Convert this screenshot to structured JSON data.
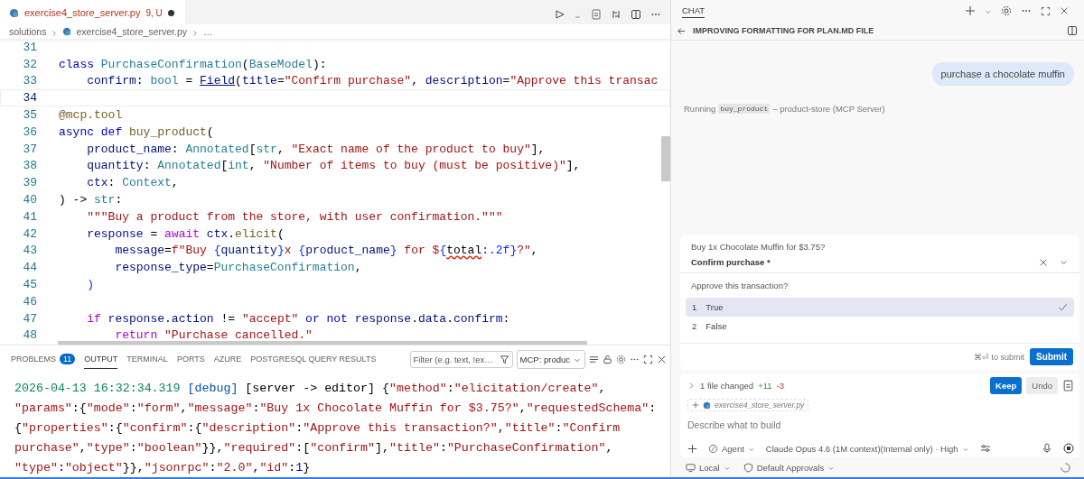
{
  "editor": {
    "tab": {
      "filename": "exercise4_store_server.py",
      "badge": "9, U",
      "dirty": true
    },
    "breadcrumb": [
      "solutions",
      "exercise4_store_server.py",
      "…"
    ],
    "lines": [
      {
        "number": "31",
        "current": false
      },
      {
        "number": "32",
        "current": false,
        "tokens": [
          {
            "kind": "kw",
            "text": "class "
          },
          {
            "kind": "type",
            "text": "PurchaseConfirmation"
          },
          {
            "kind": "plain",
            "text": "("
          },
          {
            "kind": "type",
            "text": "BaseModel"
          },
          {
            "kind": "plain",
            "text": "):"
          }
        ]
      },
      {
        "number": "33",
        "current": false,
        "tokens": [
          {
            "kind": "var",
            "text": "    confirm"
          },
          {
            "kind": "plain",
            "text": ": "
          },
          {
            "kind": "type",
            "text": "bool"
          },
          {
            "kind": "plain",
            "text": " = "
          },
          {
            "kind": "link",
            "text": "Field"
          },
          {
            "kind": "plain",
            "text": "("
          },
          {
            "kind": "var",
            "text": "title"
          },
          {
            "kind": "plain",
            "text": "="
          },
          {
            "kind": "str",
            "text": "\"Confirm purchase\""
          },
          {
            "kind": "plain",
            "text": ", "
          },
          {
            "kind": "var",
            "text": "description"
          },
          {
            "kind": "plain",
            "text": "="
          },
          {
            "kind": "str",
            "text": "\"Approve this transac"
          }
        ]
      },
      {
        "number": "34",
        "current": true
      },
      {
        "number": "35",
        "current": false,
        "tokens": [
          {
            "kind": "deco",
            "text": "@mcp.tool"
          }
        ]
      },
      {
        "number": "36",
        "current": false,
        "tokens": [
          {
            "kind": "kw",
            "text": "async def "
          },
          {
            "kind": "fn",
            "text": "buy_product"
          },
          {
            "kind": "plain",
            "text": "("
          }
        ]
      },
      {
        "number": "37",
        "current": false,
        "tokens": [
          {
            "kind": "var",
            "text": "    product_name"
          },
          {
            "kind": "plain",
            "text": ": "
          },
          {
            "kind": "type",
            "text": "Annotated"
          },
          {
            "kind": "plain",
            "text": "["
          },
          {
            "kind": "type",
            "text": "str"
          },
          {
            "kind": "plain",
            "text": ", "
          },
          {
            "kind": "str",
            "text": "\"Exact name of the product to buy\""
          },
          {
            "kind": "plain",
            "text": "],"
          }
        ]
      },
      {
        "number": "38",
        "current": false,
        "tokens": [
          {
            "kind": "var",
            "text": "    quantity"
          },
          {
            "kind": "plain",
            "text": ": "
          },
          {
            "kind": "type",
            "text": "Annotated"
          },
          {
            "kind": "plain",
            "text": "["
          },
          {
            "kind": "type",
            "text": "int"
          },
          {
            "kind": "plain",
            "text": ", "
          },
          {
            "kind": "str",
            "text": "\"Number of items to buy (must be positive)\""
          },
          {
            "kind": "plain",
            "text": "],"
          }
        ]
      },
      {
        "number": "39",
        "current": false,
        "tokens": [
          {
            "kind": "var",
            "text": "    ctx"
          },
          {
            "kind": "plain",
            "text": ": "
          },
          {
            "kind": "type",
            "text": "Context"
          },
          {
            "kind": "plain",
            "text": ","
          }
        ]
      },
      {
        "number": "40",
        "current": false,
        "tokens": [
          {
            "kind": "plain",
            "text": ") -> "
          },
          {
            "kind": "type",
            "text": "str"
          },
          {
            "kind": "plain",
            "text": ":"
          }
        ]
      },
      {
        "number": "41",
        "current": false,
        "tokens": [
          {
            "kind": "str",
            "text": "    \"\"\"Buy a product from the store, with user confirmation.\"\"\""
          }
        ]
      },
      {
        "number": "42",
        "current": false,
        "tokens": [
          {
            "kind": "var",
            "text": "    response"
          },
          {
            "kind": "plain",
            "text": " = "
          },
          {
            "kind": "ctrl",
            "text": "await "
          },
          {
            "kind": "var",
            "text": "ctx"
          },
          {
            "kind": "plain",
            "text": "."
          },
          {
            "kind": "fn",
            "text": "elicit"
          },
          {
            "kind": "plain",
            "text": "("
          }
        ]
      },
      {
        "number": "43",
        "current": false,
        "tokens": [
          {
            "kind": "var",
            "text": "        message"
          },
          {
            "kind": "plain",
            "text": "="
          },
          {
            "kind": "str",
            "text": "f\"Buy "
          },
          {
            "kind": "brace",
            "text": "{"
          },
          {
            "kind": "var",
            "text": "quantity"
          },
          {
            "kind": "brace",
            "text": "}"
          },
          {
            "kind": "str",
            "text": "x "
          },
          {
            "kind": "brace",
            "text": "{"
          },
          {
            "kind": "var",
            "text": "product_name"
          },
          {
            "kind": "brace",
            "text": "}"
          },
          {
            "kind": "str",
            "text": " for $"
          },
          {
            "kind": "brace",
            "text": "{"
          },
          {
            "kind": "err",
            "text": "total"
          },
          {
            "kind": "brace",
            "text": ":.2f}"
          },
          {
            "kind": "str",
            "text": "?\""
          },
          {
            "kind": "plain",
            "text": ","
          }
        ]
      },
      {
        "number": "44",
        "current": false,
        "tokens": [
          {
            "kind": "var",
            "text": "        response_type"
          },
          {
            "kind": "plain",
            "text": "="
          },
          {
            "kind": "type",
            "text": "PurchaseConfirmation"
          },
          {
            "kind": "plain",
            "text": ","
          }
        ]
      },
      {
        "number": "45",
        "current": false,
        "tokens": [
          {
            "kind": "brace",
            "text": "    )"
          }
        ]
      },
      {
        "number": "46",
        "current": false
      },
      {
        "number": "47",
        "current": false,
        "tokens": [
          {
            "kind": "ctrl",
            "text": "    if "
          },
          {
            "kind": "var",
            "text": "response"
          },
          {
            "kind": "plain",
            "text": "."
          },
          {
            "kind": "var",
            "text": "action"
          },
          {
            "kind": "plain",
            "text": " != "
          },
          {
            "kind": "str",
            "text": "\"accept\""
          },
          {
            "kind": "kw",
            "text": " or not "
          },
          {
            "kind": "var",
            "text": "response"
          },
          {
            "kind": "plain",
            "text": "."
          },
          {
            "kind": "var",
            "text": "data"
          },
          {
            "kind": "plain",
            "text": "."
          },
          {
            "kind": "var",
            "text": "confirm"
          },
          {
            "kind": "plain",
            "text": ":"
          }
        ]
      },
      {
        "number": "48",
        "current": false,
        "tokens": [
          {
            "kind": "ctrl",
            "text": "        return "
          },
          {
            "kind": "str",
            "text": "\"Purchase cancelled.\""
          }
        ]
      }
    ]
  },
  "panel": {
    "tabs": [
      {
        "label": "PROBLEMS",
        "count": "11",
        "selected": false
      },
      {
        "label": "OUTPUT",
        "selected": true
      },
      {
        "label": "TERMINAL",
        "selected": false
      },
      {
        "label": "PORTS",
        "selected": false
      },
      {
        "label": "AZURE",
        "selected": false
      },
      {
        "label": "POSTGRESQL QUERY RESULTS",
        "selected": false
      }
    ],
    "filter": {
      "placeholder": "Filter (e.g. text, !ex…"
    },
    "channel": "MCP: produc",
    "log": [
      [
        {
          "kind": "time",
          "text": "2026-04-13 16:32:34.319 "
        },
        {
          "kind": "tag",
          "text": "[debug]"
        },
        {
          "kind": "plain",
          "text": " [server -> editor] {"
        },
        {
          "kind": "str",
          "text": "\"method\""
        },
        {
          "kind": "plain",
          "text": ":"
        },
        {
          "kind": "str",
          "text": "\"elicitation/create\""
        },
        {
          "kind": "plain",
          "text": ","
        }
      ],
      [
        {
          "kind": "str",
          "text": "\"params\""
        },
        {
          "kind": "plain",
          "text": ":{"
        },
        {
          "kind": "str",
          "text": "\"mode\""
        },
        {
          "kind": "plain",
          "text": ":"
        },
        {
          "kind": "str",
          "text": "\"form\""
        },
        {
          "kind": "plain",
          "text": ","
        },
        {
          "kind": "str",
          "text": "\"message\""
        },
        {
          "kind": "plain",
          "text": ":"
        },
        {
          "kind": "str",
          "text": "\"Buy 1x Chocolate Muffin for $3.75?\""
        },
        {
          "kind": "plain",
          "text": ","
        },
        {
          "kind": "str",
          "text": "\"requestedSchema\""
        },
        {
          "kind": "plain",
          "text": ":"
        }
      ],
      [
        {
          "kind": "plain",
          "text": "{"
        },
        {
          "kind": "str",
          "text": "\"properties\""
        },
        {
          "kind": "plain",
          "text": ":{"
        },
        {
          "kind": "str",
          "text": "\"confirm\""
        },
        {
          "kind": "plain",
          "text": ":{"
        },
        {
          "kind": "str",
          "text": "\"description\""
        },
        {
          "kind": "plain",
          "text": ":"
        },
        {
          "kind": "str",
          "text": "\"Approve this transaction?\""
        },
        {
          "kind": "plain",
          "text": ","
        },
        {
          "kind": "str",
          "text": "\"title\""
        },
        {
          "kind": "plain",
          "text": ":"
        },
        {
          "kind": "str",
          "text": "\"Confirm"
        }
      ],
      [
        {
          "kind": "str",
          "text": "purchase\""
        },
        {
          "kind": "plain",
          "text": ","
        },
        {
          "kind": "str",
          "text": "\"type\""
        },
        {
          "kind": "plain",
          "text": ":"
        },
        {
          "kind": "str",
          "text": "\"boolean\""
        },
        {
          "kind": "plain",
          "text": "}},"
        },
        {
          "kind": "str",
          "text": "\"required\""
        },
        {
          "kind": "plain",
          "text": ":["
        },
        {
          "kind": "str",
          "text": "\"confirm\""
        },
        {
          "kind": "plain",
          "text": "],"
        },
        {
          "kind": "str",
          "text": "\"title\""
        },
        {
          "kind": "plain",
          "text": ":"
        },
        {
          "kind": "str",
          "text": "\"PurchaseConfirmation\""
        },
        {
          "kind": "plain",
          "text": ","
        }
      ],
      [
        {
          "kind": "str",
          "text": "\"type\""
        },
        {
          "kind": "plain",
          "text": ":"
        },
        {
          "kind": "str",
          "text": "\"object\""
        },
        {
          "kind": "plain",
          "text": "}},"
        },
        {
          "kind": "str",
          "text": "\"jsonrpc\""
        },
        {
          "kind": "plain",
          "text": ":"
        },
        {
          "kind": "str",
          "text": "\"2.0\""
        },
        {
          "kind": "plain",
          "text": ","
        },
        {
          "kind": "str",
          "text": "\"id\""
        },
        {
          "kind": "plain",
          "text": ":"
        },
        {
          "kind": "num",
          "text": "1"
        },
        {
          "kind": "plain",
          "text": "}"
        }
      ]
    ]
  },
  "chat": {
    "header": "CHAT",
    "title": "IMPROVING FORMATTING FOR PLAN.MD FILE",
    "user_message": "purchase a chocolate muffin",
    "status": {
      "prefix": "Running",
      "tool": "buy_product",
      "suffix": "– product-store (MCP Server)"
    },
    "form": {
      "message": "Buy 1x Chocolate Muffin for $3.75?",
      "field_title": "Confirm purchase *",
      "description": "Approve this transaction?",
      "options": [
        {
          "number": "1",
          "label": "True",
          "selected": true
        },
        {
          "number": "2",
          "label": "False",
          "selected": false
        }
      ],
      "hint": "⌘⏎ to submit",
      "submit": "Submit"
    },
    "changes": {
      "summary": "1 file changed",
      "added": "+11",
      "removed": "-3",
      "keep": "Keep",
      "undo": "Undo",
      "file": "exercise4_store_server.py"
    },
    "input": {
      "placeholder": "Describe what to build",
      "mode": "Agent",
      "model": "Claude Opus 4.6 (1M context)(Internal only) · High"
    },
    "footer": {
      "location": "Local",
      "approvals": "Default Approvals"
    }
  }
}
